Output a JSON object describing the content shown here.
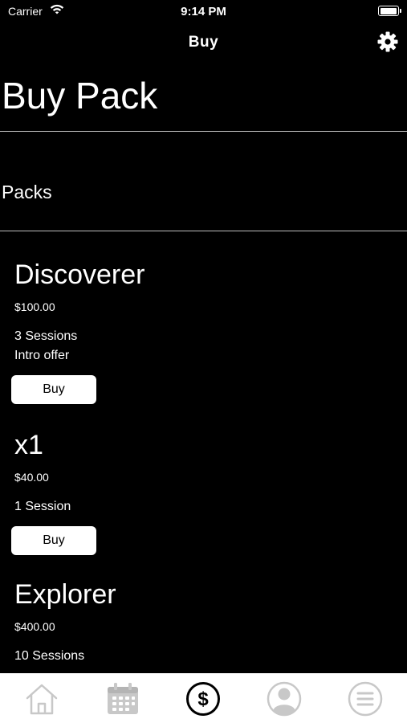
{
  "status_bar": {
    "carrier": "Carrier",
    "time": "9:14 PM"
  },
  "nav": {
    "title": "Buy",
    "settings_icon": "gear-icon"
  },
  "page": {
    "title": "Buy Pack",
    "section": "Packs"
  },
  "packs": [
    {
      "name": "Discoverer",
      "price": "$100.00",
      "desc": [
        "3 Sessions",
        "Intro offer"
      ],
      "button": "Buy"
    },
    {
      "name": "x1",
      "price": "$40.00",
      "desc": [
        "1 Session"
      ],
      "button": "Buy"
    },
    {
      "name": "Explorer",
      "price": "$400.00",
      "desc": [
        "10 Sessions"
      ]
    }
  ],
  "tab_bar": {
    "items": [
      {
        "icon": "home-icon",
        "active": false
      },
      {
        "icon": "calendar-icon",
        "active": false
      },
      {
        "icon": "dollar-icon",
        "active": true
      },
      {
        "icon": "profile-icon",
        "active": false
      },
      {
        "icon": "menu-icon",
        "active": false
      }
    ],
    "colors": {
      "active": "#000000",
      "inactive": "#c8c8c8"
    }
  }
}
